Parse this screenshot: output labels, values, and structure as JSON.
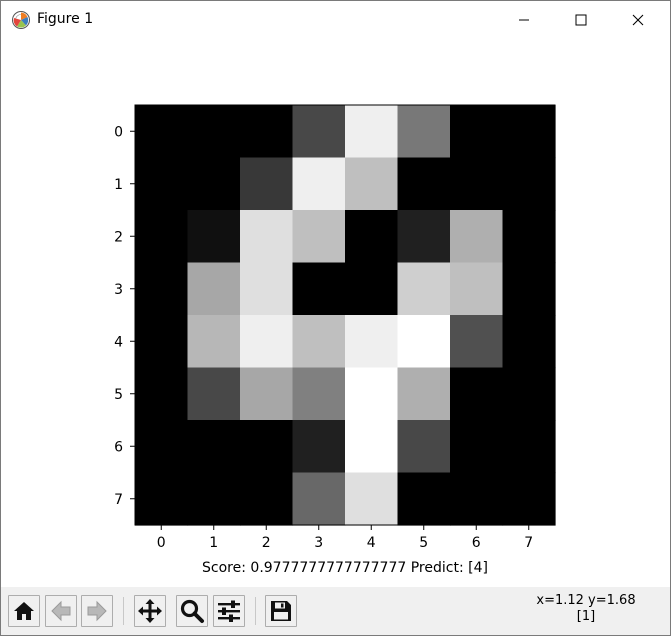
{
  "window": {
    "title": "Figure 1",
    "icons": {
      "app": "matplotlib-icon",
      "minimize": "minimize-icon",
      "maximize": "maximize-icon",
      "close": "close-icon"
    }
  },
  "chart_data": {
    "type": "heatmap",
    "colormap": "gray",
    "title": "",
    "xlabel": "Score: 0.9777777777777777  Predict: [4]",
    "ylabel": "",
    "x_ticks": [
      "0",
      "1",
      "2",
      "3",
      "4",
      "5",
      "6",
      "7"
    ],
    "y_ticks": [
      "0",
      "1",
      "2",
      "3",
      "4",
      "5",
      "6",
      "7"
    ],
    "value_range": [
      0,
      16
    ],
    "values": [
      [
        0,
        0,
        0,
        4.5,
        15,
        7.5,
        0,
        0
      ],
      [
        0,
        0,
        3.5,
        15,
        12,
        0,
        0,
        0
      ],
      [
        0,
        1,
        14,
        12,
        0,
        2,
        11,
        0
      ],
      [
        0,
        10.5,
        14,
        0,
        0,
        13,
        12,
        0
      ],
      [
        0,
        11.5,
        15,
        12,
        15,
        16,
        5,
        0
      ],
      [
        0,
        4.5,
        10.5,
        8,
        16,
        11,
        0,
        0
      ],
      [
        0,
        0,
        0,
        2,
        16,
        4.5,
        0,
        0
      ],
      [
        0,
        0,
        0,
        6.5,
        14,
        0,
        0,
        0
      ]
    ]
  },
  "toolbar": {
    "buttons": [
      {
        "name": "home-button",
        "icon": "home-icon"
      },
      {
        "name": "back-button",
        "icon": "arrow-left-icon"
      },
      {
        "name": "forward-button",
        "icon": "arrow-right-icon"
      },
      {
        "name": "pan-button",
        "icon": "move-icon"
      },
      {
        "name": "zoom-button",
        "icon": "magnifier-icon"
      },
      {
        "name": "subplots-button",
        "icon": "sliders-icon"
      },
      {
        "name": "save-button",
        "icon": "floppy-disk-icon"
      }
    ],
    "coords_line1": "x=1.12 y=1.68",
    "coords_line2": "[1]"
  },
  "colors": {
    "toolbar_bg": "#f0f0f0",
    "figure_bg": "#ffffff"
  }
}
